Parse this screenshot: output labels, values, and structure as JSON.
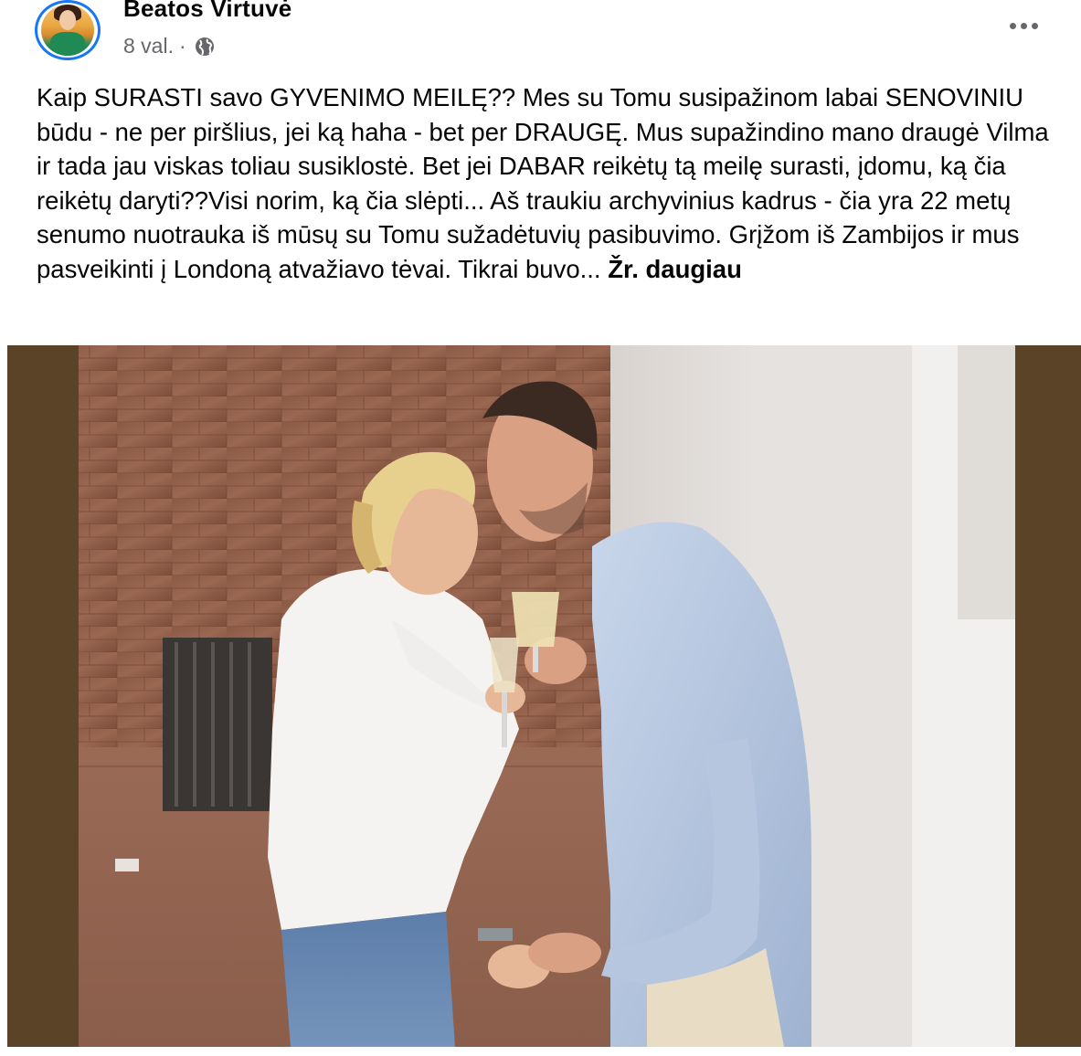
{
  "post": {
    "page_name": "Beatos Virtuvė",
    "time": "8 val.",
    "separator": "·",
    "text": "Kaip  SURASTI savo GYVENIMO MEILĘ?? Mes su Tomu susipažinom labai SENOVINIU būdu - ne per piršlius, jei ką haha - bet per DRAUGĘ. Mus supažindino mano draugė Vilma ir tada jau viskas toliau susiklostė. Bet jei DABAR reikėtų tą meilę surasti, įdomu, ką čia reikėtų daryti??Visi norim, ką čia slėpti... Aš traukiu archyvinius kadrus - čia yra 22 metų senumo nuotrauka iš mūsų su Tomu sužadėtuvių pasibuvimo. Grįžom iš Zambijos ir mus pasveikinti į Londoną atvažiavo tėvai. Tikrai buvo... ",
    "see_more": "Žr. daugiau"
  },
  "icons": {
    "audience": "globe-icon",
    "options": "more-horizontal-icon"
  },
  "colors": {
    "avatar_ring": "#1877f2",
    "meta_text": "#65676b",
    "photo_frame": "#5b4328"
  }
}
